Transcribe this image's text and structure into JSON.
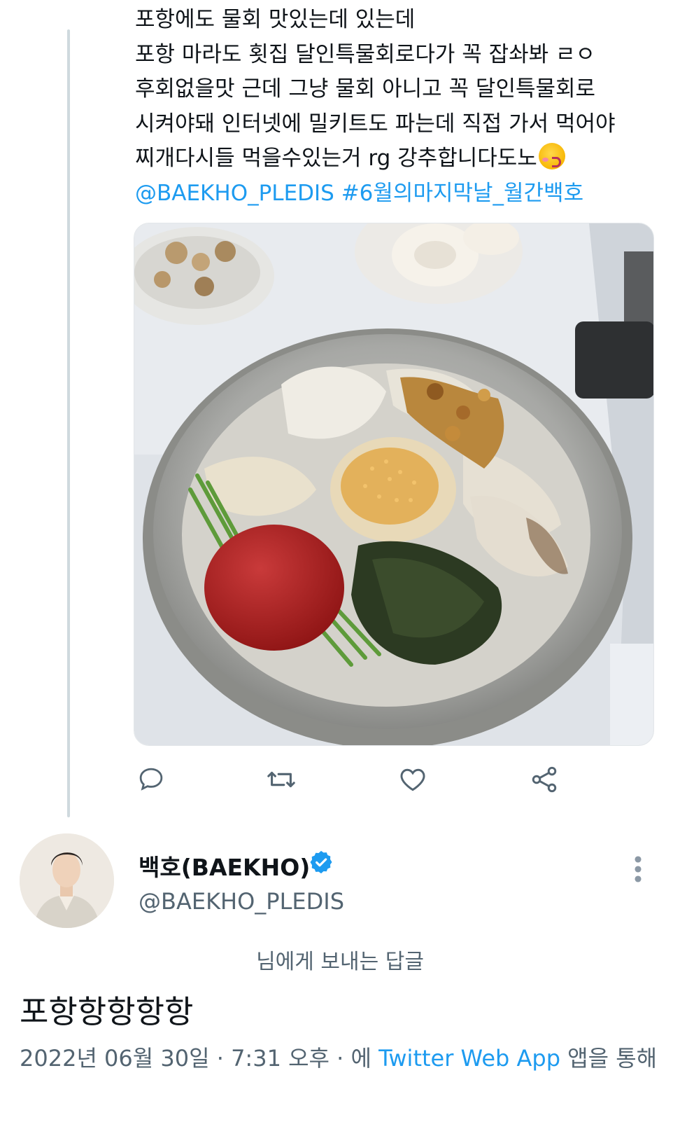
{
  "tweet": {
    "lines": [
      "포항에도 물회 맛있는데 있는데",
      "포항 마라도 횟집 달인특물회로다가 꼭 잡솨봐 ㄹㅇ",
      "후회없을맛 근데 그냥 물회 아니고 꼭 달인특물회로",
      "시켜야돼 인터넷에 밀키트도 파는데 직접 가서 먹어야",
      "찌개다시들 먹을수있는거 rg 강추합니다도노"
    ],
    "emoji": "kissing-face-emoji",
    "mention": "@BAEKHO_PLEDIS",
    "hashtag": "#6월의마지막날_월간백호"
  },
  "actions": {
    "reply_icon": "comment-icon",
    "retweet_icon": "retweet-icon",
    "like_icon": "heart-icon",
    "share_icon": "share-icon"
  },
  "profile": {
    "name": "백호(BAEKHO)",
    "handle": "@BAEKHO_PLEDIS",
    "verified_icon": "verified-badge-icon",
    "more_icon": "more-vertical-icon"
  },
  "reply": {
    "replying_to": "님에게 보내는 답글",
    "text": "포항항항항항"
  },
  "meta": {
    "date": "2022년 06월 30일",
    "separator1": " · ",
    "time": "7:31 오후",
    "separator2": " · ",
    "via_prefix": "에 ",
    "source": "Twitter Web App",
    "via_suffix": " 앱을 통해"
  },
  "colors": {
    "link": "#1d9bf0",
    "text": "#0f1419",
    "secondary": "#536471",
    "thread_line": "#cfd9de"
  }
}
